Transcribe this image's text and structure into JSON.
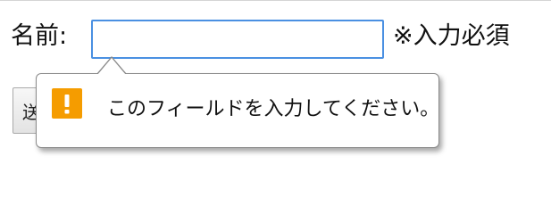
{
  "form": {
    "label": "名前:",
    "input_value": "",
    "required_note": "※入力必須",
    "submit_label": "送信"
  },
  "validation_tooltip": {
    "icon": "warning-icon",
    "message": "このフィールドを入力してください。"
  },
  "colors": {
    "input_focus_border": "#4a90e2",
    "warning_icon_bg": "#f59c00",
    "tooltip_border": "#8a8a8a"
  }
}
